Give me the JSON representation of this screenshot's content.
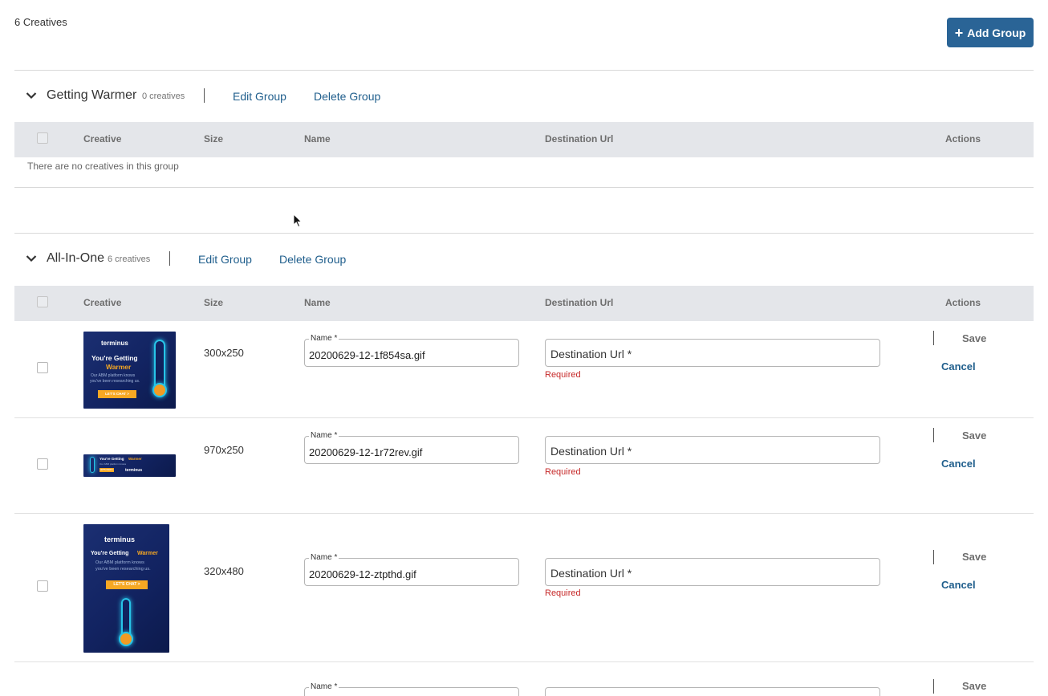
{
  "header": {
    "creative_count": "6 Creatives",
    "add_group_label": "Add Group"
  },
  "columns": {
    "creative": "Creative",
    "size": "Size",
    "name": "Name",
    "destination_url": "Destination Url",
    "actions": "Actions"
  },
  "groups": [
    {
      "title": "Getting Warmer",
      "count": "0 creatives",
      "edit_label": "Edit Group",
      "delete_label": "Delete Group",
      "empty_message": "There are no creatives in this group"
    },
    {
      "title": "All-In-One",
      "count": "6 creatives",
      "edit_label": "Edit Group",
      "delete_label": "Delete Group"
    }
  ],
  "rows": [
    {
      "size": "300x250",
      "name_label": "Name *",
      "name_value": "20200629-12-1f854sa.gif",
      "url_placeholder": "Destination Url *",
      "error": "Required",
      "save_label": "Save",
      "cancel_label": "Cancel"
    },
    {
      "size": "970x250",
      "name_label": "Name *",
      "name_value": "20200629-12-1r72rev.gif",
      "url_placeholder": "Destination Url *",
      "error": "Required",
      "save_label": "Save",
      "cancel_label": "Cancel"
    },
    {
      "size": "320x480",
      "name_label": "Name *",
      "name_value": "20200629-12-ztpthd.gif",
      "url_placeholder": "Destination Url *",
      "error": "Required",
      "save_label": "Save",
      "cancel_label": "Cancel"
    },
    {
      "name_label": "Name *",
      "save_label": "Save"
    }
  ],
  "banner": {
    "brand": "terminus",
    "headline": "You're Getting",
    "headline_accent": "Warmer",
    "sub_line1": "Our ABM platform knows",
    "sub_line2": "you've been researching us.",
    "cta": "LET'S CHAT >"
  },
  "colors": {
    "primary": "#2a6496",
    "link": "#1f5e8c",
    "error": "#c62828",
    "banner_bg": "#122361",
    "banner_accent": "#f7a823",
    "thermo_glow": "#27c4e8"
  },
  "icons": [
    "plus-icon",
    "chevron-down-icon",
    "mouse-cursor-icon",
    "thermometer-icon"
  ]
}
